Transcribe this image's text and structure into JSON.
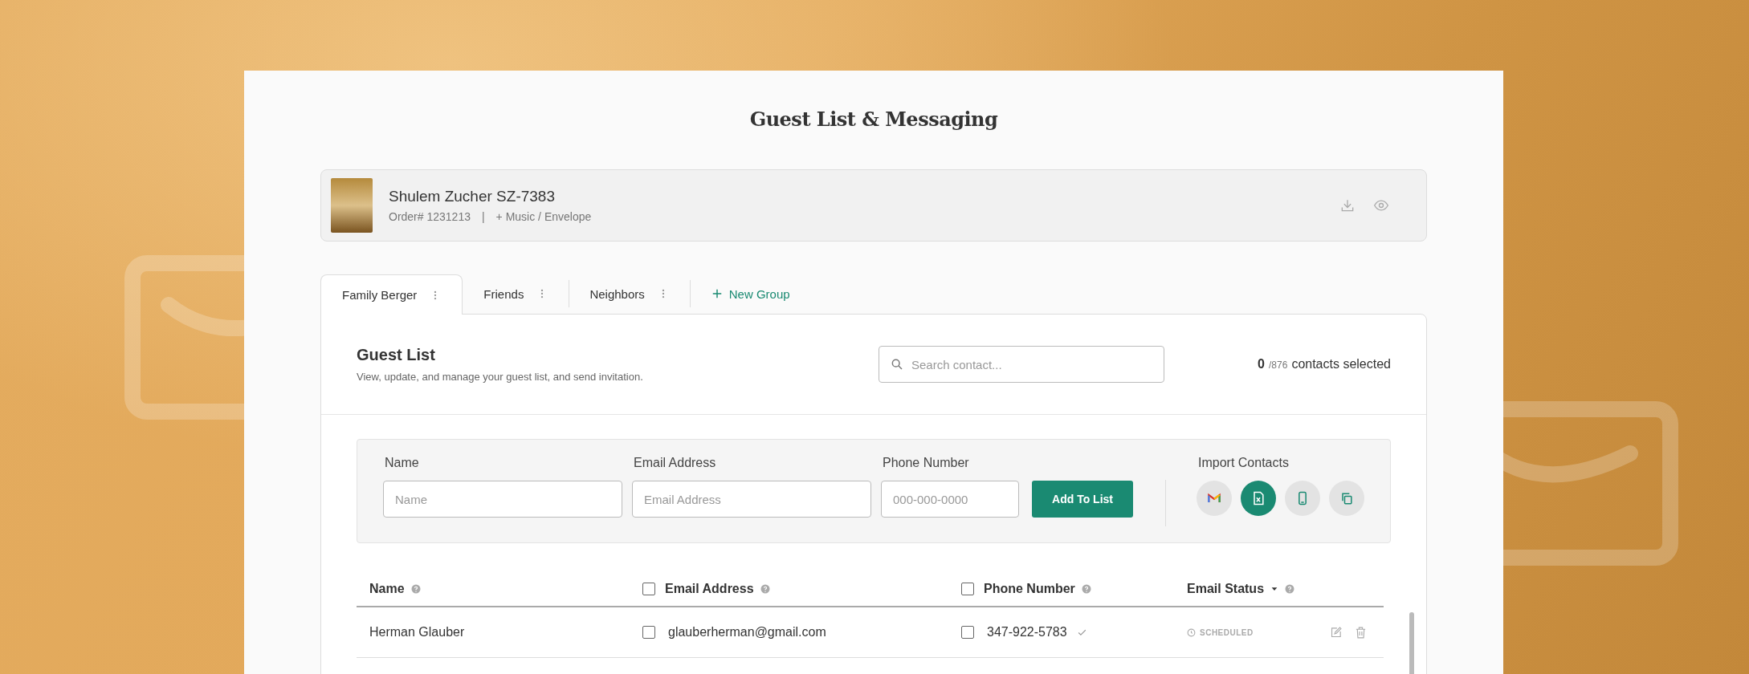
{
  "page": {
    "title": "Guest List & Messaging"
  },
  "order": {
    "name": "Shulem Zucher SZ-7383",
    "order_number": "Order# 1231213",
    "separator": "|",
    "addon": "+ Music / Envelope"
  },
  "tabs": [
    {
      "label": "Family Berger",
      "selected": true
    },
    {
      "label": "Friends",
      "selected": false
    },
    {
      "label": "Neighbors",
      "selected": false
    }
  ],
  "new_group": {
    "label": "New Group"
  },
  "guest_list": {
    "title": "Guest List",
    "description": "View, update, and manage your guest list, and send invitation.",
    "search_placeholder": "Search contact...",
    "selected_count": "0",
    "total": "/876",
    "selected_label": "contacts selected"
  },
  "add_form": {
    "fields": [
      {
        "label": "Name",
        "placeholder": "Name",
        "kind": "wide"
      },
      {
        "label": "Email Address",
        "placeholder": "Email Address",
        "kind": "wide"
      },
      {
        "label": "Phone Number",
        "placeholder": "000-000-0000",
        "kind": "narrow"
      }
    ],
    "button": "Add To List",
    "import_label": "Import Contacts",
    "import_sources": [
      {
        "kind": "gmail",
        "selected": false
      },
      {
        "kind": "excel",
        "selected": true
      },
      {
        "kind": "phone",
        "selected": false
      },
      {
        "kind": "copy",
        "selected": false
      }
    ]
  },
  "table": {
    "columns": [
      {
        "label": "Name",
        "kind": "plain"
      },
      {
        "label": "Email Address",
        "kind": "checkbox",
        "checked": false
      },
      {
        "label": "Phone Number",
        "kind": "checkbox",
        "checked": false
      },
      {
        "label": "Email Status",
        "kind": "dropdown"
      }
    ],
    "rows": [
      {
        "name": "Herman Glauber",
        "email": "glauberherman@gmail.com",
        "email_checked": false,
        "phone": "347-922-5783",
        "phone_checked": false,
        "phone_verified": true,
        "status": "SCHEDULED"
      }
    ]
  }
}
